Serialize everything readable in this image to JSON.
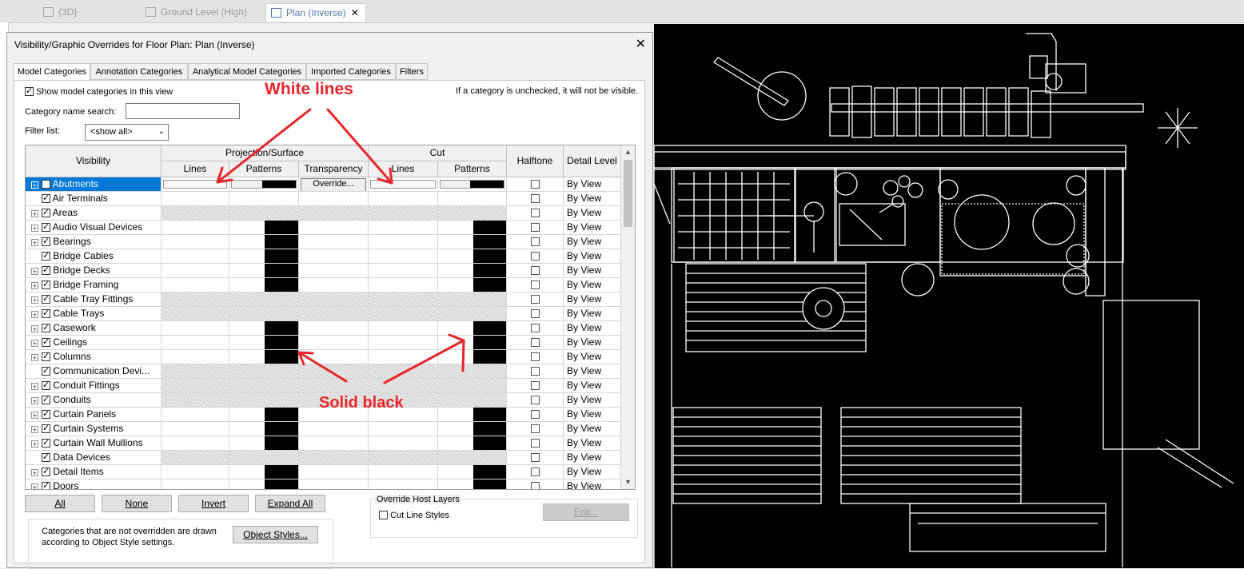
{
  "view_tabs": [
    {
      "label": "{3D}",
      "active": false
    },
    {
      "label": "Ground Level (High)",
      "active": false
    },
    {
      "label": "Plan (Inverse)",
      "active": true
    }
  ],
  "dialog": {
    "title": "Visibility/Graphic Overrides for Floor Plan: Plan (Inverse)",
    "tabs": [
      "Model Categories",
      "Annotation Categories",
      "Analytical Model Categories",
      "Imported Categories",
      "Filters"
    ],
    "show_categories_label": "Show model categories in this view",
    "hint": "If a category is unchecked, it will not be visible.",
    "search_label": "Category name search:",
    "search_value": "",
    "filter_label": "Filter list:",
    "filter_value": "<show all>",
    "headers": {
      "visibility": "Visibility",
      "projection_surface": "Projection/Surface",
      "cut": "Cut",
      "lines": "Lines",
      "patterns": "Patterns",
      "transparency": "Transparency",
      "cut_lines": "Lines",
      "cut_patterns": "Patterns",
      "halftone": "Halftone",
      "detail_level": "Detail Level"
    },
    "override_label": "Override...",
    "rows": [
      {
        "name": "Abutments",
        "exp": true,
        "sel": true,
        "proj": "override",
        "cut": "override"
      },
      {
        "name": "Air Terminals",
        "exp": false,
        "proj": "none",
        "cut": "none"
      },
      {
        "name": "Areas",
        "exp": true,
        "proj": "hatch",
        "cut": "hatch"
      },
      {
        "name": "Audio Visual Devices",
        "exp": true,
        "proj": "black",
        "cut": "black"
      },
      {
        "name": "Bearings",
        "exp": true,
        "proj": "black",
        "cut": "black"
      },
      {
        "name": "Bridge Cables",
        "exp": false,
        "proj": "black",
        "cut": "black"
      },
      {
        "name": "Bridge Decks",
        "exp": true,
        "proj": "black",
        "cut": "black"
      },
      {
        "name": "Bridge Framing",
        "exp": true,
        "proj": "black",
        "cut": "black"
      },
      {
        "name": "Cable Tray Fittings",
        "exp": true,
        "proj": "hatch",
        "cut": "hatch"
      },
      {
        "name": "Cable Trays",
        "exp": true,
        "proj": "hatch",
        "cut": "hatch"
      },
      {
        "name": "Casework",
        "exp": true,
        "proj": "black",
        "cut": "black"
      },
      {
        "name": "Ceilings",
        "exp": true,
        "proj": "black",
        "cut": "black"
      },
      {
        "name": "Columns",
        "exp": true,
        "proj": "black",
        "cut": "black"
      },
      {
        "name": "Communication Devi...",
        "exp": false,
        "proj": "hatch",
        "cut": "hatch"
      },
      {
        "name": "Conduit Fittings",
        "exp": true,
        "proj": "hatch",
        "cut": "hatch"
      },
      {
        "name": "Conduits",
        "exp": true,
        "proj": "hatch",
        "cut": "hatch"
      },
      {
        "name": "Curtain Panels",
        "exp": true,
        "proj": "black",
        "cut": "black"
      },
      {
        "name": "Curtain Systems",
        "exp": true,
        "proj": "black",
        "cut": "black"
      },
      {
        "name": "Curtain Wall Mullions",
        "exp": true,
        "proj": "black",
        "cut": "black"
      },
      {
        "name": "Data Devices",
        "exp": false,
        "proj": "hatch",
        "cut": "hatch"
      },
      {
        "name": "Detail Items",
        "exp": true,
        "proj": "black",
        "cut": "black"
      },
      {
        "name": "Doors",
        "exp": true,
        "proj": "black",
        "cut": "black"
      }
    ],
    "detail_value": "By View",
    "buttons": {
      "all": "All",
      "none": "None",
      "invert": "Invert",
      "expand_all": "Expand All"
    },
    "override_host_layers": "Override Host Layers",
    "cut_line_styles": "Cut Line Styles",
    "edit": "Edit...",
    "note": "Categories that are not overridden are drawn according to Object Style settings.",
    "object_styles": "Object Styles..."
  },
  "annotations": {
    "white_lines": "White lines",
    "solid_black": "Solid black",
    "color": "#e8262b"
  }
}
